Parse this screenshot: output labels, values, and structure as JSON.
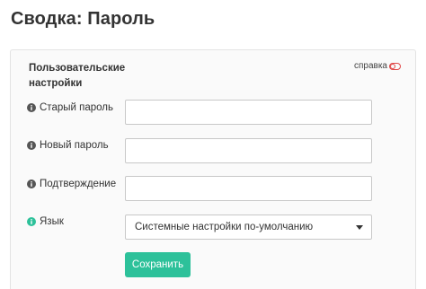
{
  "page_title": "Сводка: Пароль",
  "panel": {
    "section_title": "Пользовательские настройки",
    "help_label": "справка",
    "fields": [
      {
        "label": "Старый пароль",
        "value": "",
        "icon": "info-circle-icon"
      },
      {
        "label": "Новый пароль",
        "value": "",
        "icon": "info-circle-icon"
      },
      {
        "label": "Подтверждение",
        "value": "",
        "icon": "info-circle-icon"
      }
    ],
    "language": {
      "label": "Язык",
      "icon": "info-circle-icon",
      "icon_color": "#2dc19a",
      "selected": "Системные настройки по-умолчанию"
    },
    "save_label": "Сохранить"
  },
  "colors": {
    "accent": "#2dc19a",
    "help_icon": "#e04848"
  }
}
